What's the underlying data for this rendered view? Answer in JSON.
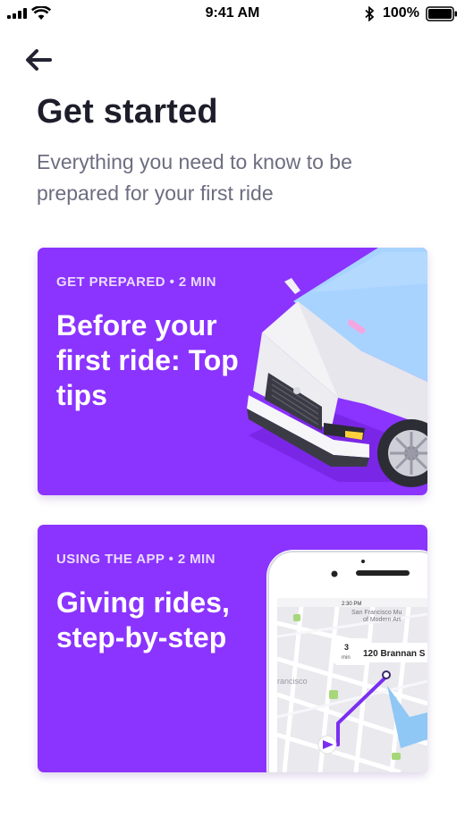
{
  "status_bar": {
    "time": "9:41 AM",
    "battery_percent": "100%"
  },
  "header": {
    "title": "Get started",
    "subtitle": "Everything you need to know to be prepared for your first ride"
  },
  "cards": [
    {
      "eyebrow": "GET PREPARED • 2 MIN",
      "headline": "Before your first ride: Top tips"
    },
    {
      "eyebrow": "USING THE APP • 2 MIN",
      "headline": "Giving rides, step-by-step",
      "phone": {
        "clock": "2:30 PM",
        "eta_value": "3",
        "eta_unit": "min",
        "destination": "120 Brannan S",
        "map_labels": [
          "San Francisco Mu",
          "of Modern Art",
          "rancisco"
        ]
      }
    }
  ],
  "colors": {
    "card_purple": "#8b33ff",
    "title": "#1e1e2b",
    "subtitle": "#6d6d80"
  }
}
